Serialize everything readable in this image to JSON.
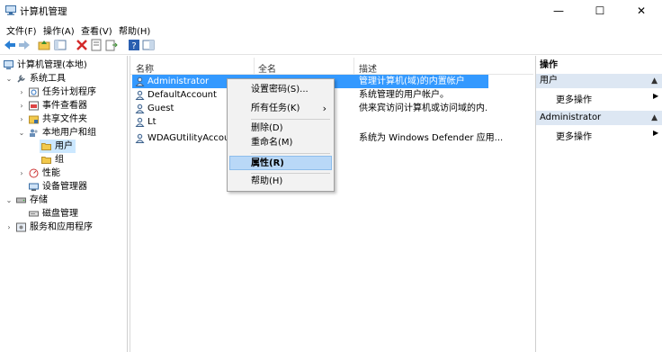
{
  "window": {
    "title": "计算机管理",
    "minimize": "—",
    "maximize": "☐",
    "close": "✕"
  },
  "menu": [
    "文件(F)",
    "操作(A)",
    "查看(V)",
    "帮助(H)"
  ],
  "tree": {
    "root": "计算机管理(本地)",
    "system_tools": "系统工具",
    "task_scheduler": "任务计划程序",
    "event_viewer": "事件查看器",
    "shared_folders": "共享文件夹",
    "local_users": "本地用户和组",
    "users": "用户",
    "groups": "组",
    "performance": "性能",
    "device_manager": "设备管理器",
    "storage": "存储",
    "disk_management": "磁盘管理",
    "services": "服务和应用程序"
  },
  "list": {
    "columns": [
      "名称",
      "全名",
      "描述"
    ],
    "rows": [
      {
        "name": "Administrator",
        "full": "",
        "desc": "管理计算机(域)的内置帐户"
      },
      {
        "name": "DefaultAccount",
        "full": "",
        "desc": "系统管理的用户帐户。"
      },
      {
        "name": "Guest",
        "full": "",
        "desc": "供来宾访问计算机或访问域的内..."
      },
      {
        "name": "Lt",
        "full": "",
        "desc": ""
      },
      {
        "name": "WDAGUtilityAccount",
        "full": "",
        "desc": "系统为 Windows Defender 应用..."
      }
    ]
  },
  "context_menu": {
    "set_password": "设置密码(S)...",
    "all_tasks": "所有任务(K)",
    "all_tasks_arrow": "›",
    "delete": "删除(D)",
    "rename": "重命名(M)",
    "properties": "属性(R)",
    "help": "帮助(H)"
  },
  "actions": {
    "title": "操作",
    "section1": "用户",
    "section1_more": "更多操作",
    "section2": "Administrator",
    "section2_more": "更多操作",
    "collapse_arrow": "▲",
    "more_arrow": "▶"
  },
  "colors": {
    "selection": "#3399ff",
    "tree_selection": "#cce8ff",
    "action_header": "#dde7f3"
  }
}
